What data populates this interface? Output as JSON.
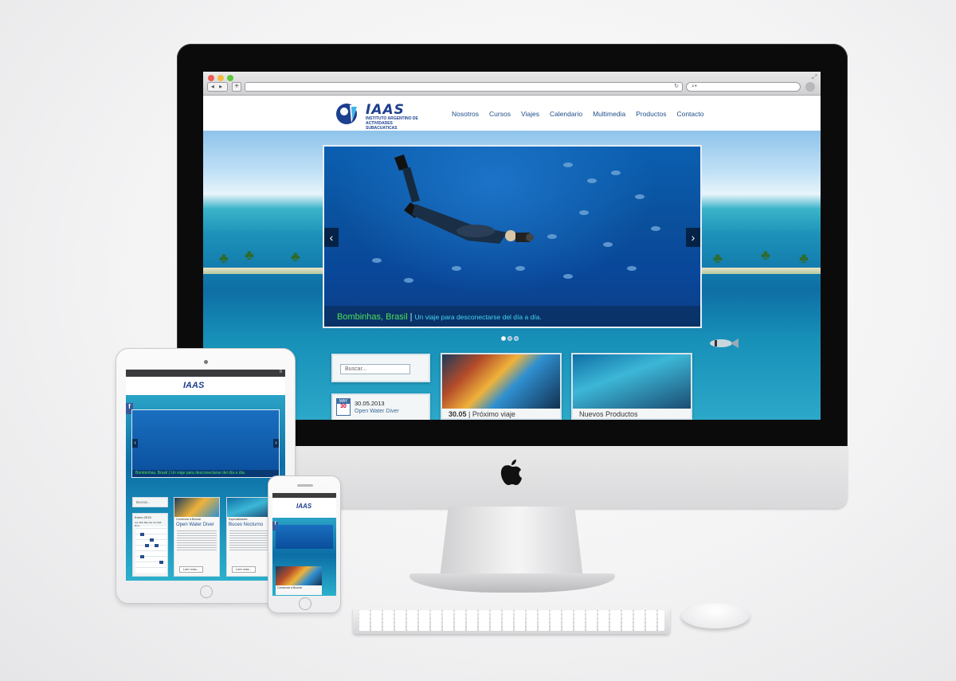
{
  "browser": {
    "nav_arrows": "◂ ▸",
    "new_tab": "+",
    "reload": "↻",
    "search_icon": "search-icon",
    "accent": "#1d3f8f"
  },
  "site": {
    "logo_text": "IAAS",
    "logo_subtitle": "INSTITUTO ARGENTINO DE ACTIVIDADES SUBACUATICAS",
    "nav": [
      "Nosotros",
      "Cursos",
      "Viajes",
      "Calendario",
      "Multimedia",
      "Productos",
      "Contacto"
    ]
  },
  "slider": {
    "title": "Bombinhas, Brasil",
    "separator": "|",
    "subtitle": "Un viaje para desconectarse del día a día.",
    "prev": "‹",
    "next": "›",
    "slide_count": 3,
    "active_slide": 1
  },
  "widgets": {
    "search_placeholder": "Buscar...",
    "calendar_month": "MAY",
    "calendar_day": "30",
    "calendar_date": "30.05.2013",
    "calendar_event": "Open Water Diver",
    "card1_date": "30.05",
    "card1_sep": "|",
    "card1_label": "Próximo viaje",
    "card2_label": "Nuevos Productos"
  },
  "tablet": {
    "menu_icon": "≡",
    "facebook": "f",
    "logo_text": "IAAS",
    "slider_caption": "Bombinhas, Brasil | Un viaje para desconectarse del día a día.",
    "search_placeholder": "Buscar...",
    "calendar_header": "Enero 2015",
    "calendar_weekdays": "Lun Mar Mié Jue Vie Sáb Dom",
    "card1_kicker": "Comenzar a Bucear",
    "card1_title": "Open Water Diver",
    "card2_kicker": "Especialidades",
    "card2_title": "Buceo Nocturno",
    "read_more": "Leer más..."
  },
  "phone": {
    "logo_text": "IAAS",
    "facebook": "f",
    "card_kicker": "Comenzar a Bucear"
  }
}
